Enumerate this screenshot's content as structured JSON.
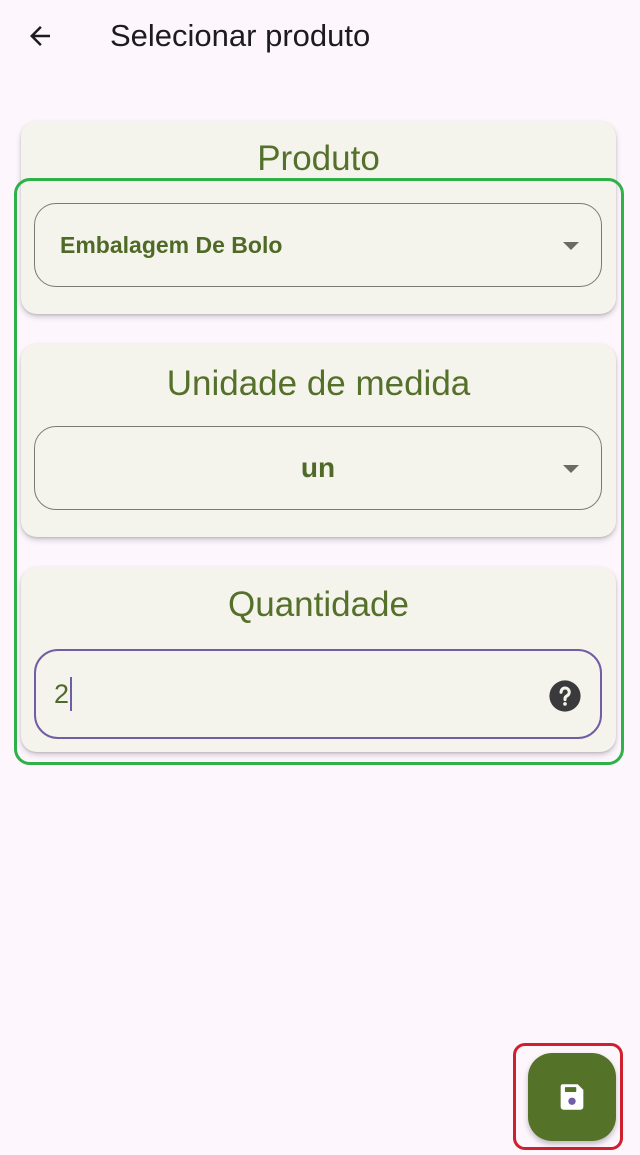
{
  "appbar": {
    "title": "Selecionar produto",
    "back_icon": "arrow-left-icon"
  },
  "cards": {
    "produto": {
      "title": "Produto",
      "selected": "Embalagem De Bolo"
    },
    "unidade": {
      "title": "Unidade de medida",
      "selected": "un"
    },
    "quantidade": {
      "title": "Quantidade",
      "value": "2",
      "help_icon": "help-circle-icon"
    }
  },
  "fab": {
    "icon": "save-icon"
  },
  "colors": {
    "accent": "#55702a",
    "focus_border": "#6f5ea5",
    "fab": "#557229",
    "highlight_green": "#2fb14a",
    "highlight_red": "#d0202e"
  }
}
